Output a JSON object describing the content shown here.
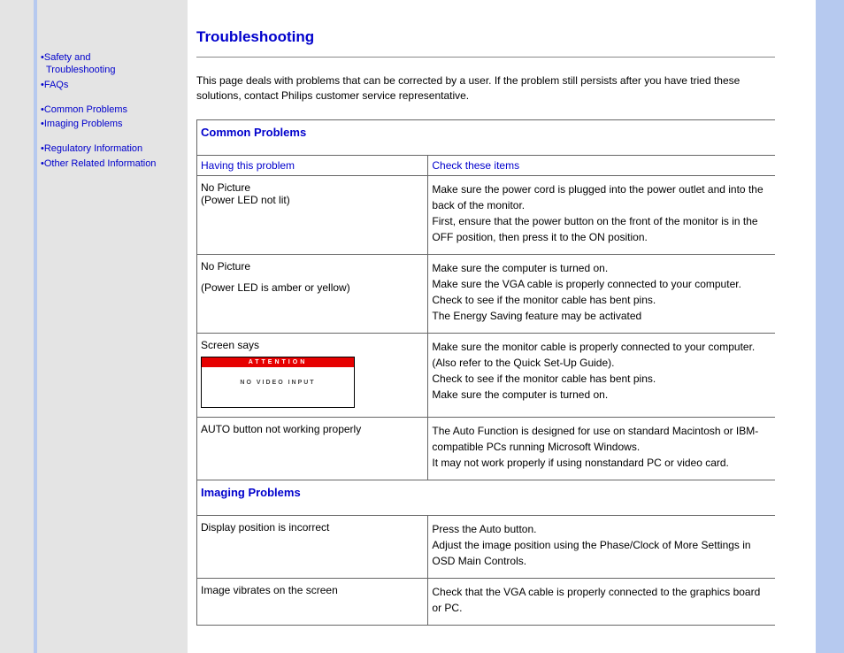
{
  "sidebar": {
    "group1": [
      {
        "label": "Safety and",
        "cont": "Troubleshooting"
      },
      {
        "label": "FAQs"
      }
    ],
    "group2": [
      {
        "label": "Common Problems"
      },
      {
        "label": "Imaging Problems"
      }
    ],
    "group3": [
      {
        "label": "Regulatory Information"
      },
      {
        "label": "Other Related Information"
      }
    ]
  },
  "page": {
    "title": "Troubleshooting",
    "intro": "This page deals with problems that can be corrected by a user. If the problem still persists after you have tried these solutions, contact Philips customer service representative."
  },
  "table": {
    "section1": "Common Problems",
    "head_left": "Having this problem",
    "head_right": "Check these items",
    "rows1": [
      {
        "problem_l1": "No Picture",
        "problem_l2": "(Power LED not lit)",
        "check": "Make sure the power cord is plugged into the power outlet and into the back of the monitor.\nFirst, ensure that the power button on the front of the monitor is in the OFF position, then press it to the ON position."
      },
      {
        "problem_l1": "No Picture",
        "problem_l2": "(Power LED is amber or yellow)",
        "check": "Make sure the computer is turned on.\nMake sure the VGA cable is properly connected to your computer.\nCheck to see if the monitor cable has bent pins.\nThe Energy Saving feature may be activated"
      },
      {
        "problem_l1": "Screen says",
        "novideo": {
          "header": "ATTENTION",
          "body": "NO VIDEO INPUT"
        },
        "check": "Make sure the monitor cable is properly connected to your computer. (Also refer to the Quick Set-Up Guide).\nCheck to see if the monitor cable has bent pins.\nMake sure the computer is turned on."
      },
      {
        "problem_l1": "AUTO button not working properly",
        "check": "The Auto Function is designed for use on standard Macintosh or IBM-compatible PCs running Microsoft Windows.\nIt may not work properly if using nonstandard PC or video card."
      }
    ],
    "section2": "Imaging Problems",
    "rows2": [
      {
        "problem_l1": "Display position is incorrect",
        "check": "Press the Auto button.\nAdjust the image position using the Phase/Clock of More Settings in OSD Main Controls."
      },
      {
        "problem_l1": "Image vibrates on the screen",
        "check": "Check that the VGA cable is properly connected to the graphics board or PC."
      }
    ]
  }
}
